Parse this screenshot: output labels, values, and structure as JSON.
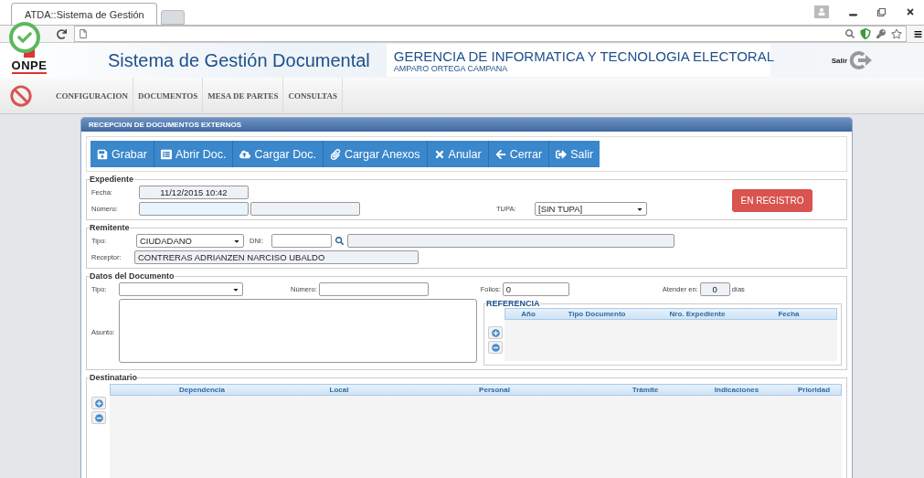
{
  "browser": {
    "tab_title": "ATDA::Sistema de Gestión"
  },
  "header": {
    "title": "Sistema de Gestión Documental",
    "org": "GERENCIA DE INFORMATICA Y TECNOLOGIA ELECTORAL",
    "user": "AMPARO ORTEGA CAMPANA",
    "logo": "ONPE",
    "logout": "Salir"
  },
  "menu": {
    "items": [
      "CONFIGURACION",
      "DOCUMENTOS",
      "MESA DE PARTES",
      "CONSULTAS"
    ]
  },
  "panel": {
    "title": "RECEPCION DE DOCUMENTOS EXTERNOS"
  },
  "toolbar": {
    "buttons": [
      "Grabar",
      "Abrir Doc.",
      "Cargar Doc.",
      "Cargar Anexos",
      "Anular",
      "Cerrar",
      "Salir"
    ]
  },
  "expediente": {
    "legend": "Expediente",
    "fecha_label": "Fecha:",
    "fecha_value": "11/12/2015 10:42",
    "numero_label": "Número:",
    "tupa_label": "TUPA:",
    "tupa_value": "[SIN TUPA]",
    "status": "EN REGISTRO"
  },
  "remitente": {
    "legend": "Remitente",
    "tipo_label": "Tipo:",
    "tipo_value": "CIUDADANO",
    "dni_label": "DNI:",
    "receptor_label": "Receptor:",
    "receptor_value": "CONTRERAS ADRIANZEN NARCISO UBALDO"
  },
  "datos": {
    "legend": "Datos del Documento",
    "tipo_label": "Tipo:",
    "numero_label": "Número:",
    "folios_label": "Folios:",
    "folios_value": "0",
    "atender_label": "Atender en:",
    "atender_value": "0",
    "dias_label": "días",
    "asunto_label": "Asunto:",
    "referencia": {
      "legend": "REFERENCIA",
      "columns": [
        "Año",
        "Tipo Documento",
        "Nro. Expediente",
        "Fecha"
      ]
    }
  },
  "destinatario": {
    "legend": "Destinatario",
    "columns": [
      "Dependencia",
      "Local",
      "Personal",
      "Trámite",
      "Indicaciones",
      "Prioridad"
    ]
  }
}
